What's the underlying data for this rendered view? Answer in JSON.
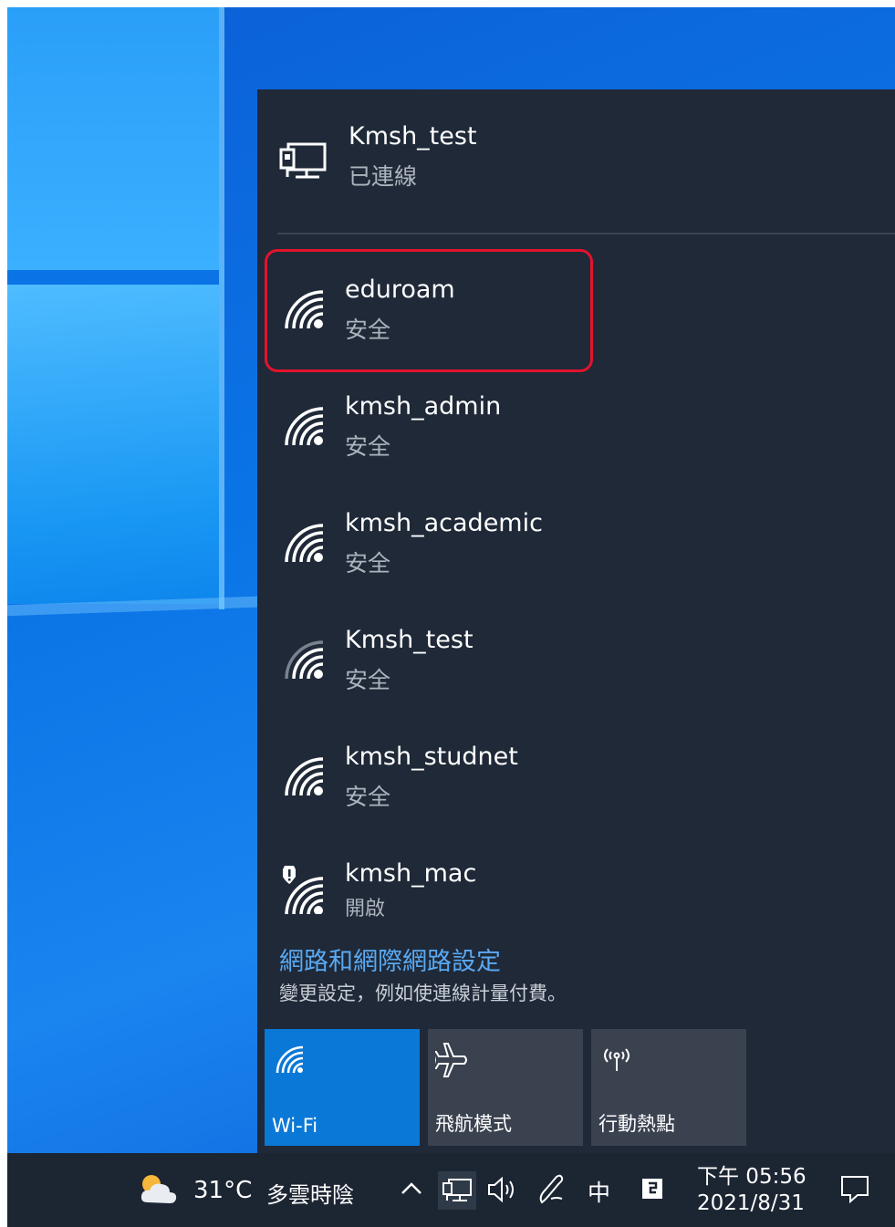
{
  "connected_network": {
    "name": "Kmsh_test",
    "status": "已連線",
    "icon": "ethernet-icon"
  },
  "networks": [
    {
      "name": "eduroam",
      "status": "安全",
      "icon": "wifi-icon",
      "highlighted": true
    },
    {
      "name": "kmsh_admin",
      "status": "安全",
      "icon": "wifi-icon"
    },
    {
      "name": "kmsh_academic",
      "status": "安全",
      "icon": "wifi-icon"
    },
    {
      "name": "Kmsh_test",
      "status": "安全",
      "icon": "wifi-icon"
    },
    {
      "name": "kmsh_studnet",
      "status": "安全",
      "icon": "wifi-icon"
    },
    {
      "name": "kmsh_mac",
      "status": "開啟",
      "icon": "wifi-warning-icon"
    }
  ],
  "settings": {
    "link": "網路和網際網路設定",
    "description": "變更設定，例如使連線計量付費。"
  },
  "quick_actions": [
    {
      "label": "Wi-Fi",
      "icon": "wifi-icon",
      "active": true
    },
    {
      "label": "飛航模式",
      "icon": "airplane-icon",
      "active": false
    },
    {
      "label": "行動熱點",
      "icon": "hotspot-icon",
      "active": false
    }
  ],
  "taskbar": {
    "weather_temp": "31°C",
    "weather_condition": "多雲時陰",
    "ime_label": "中",
    "time": "下午 05:56",
    "date": "2021/8/31"
  },
  "colors": {
    "flyout_bg": "#1f2938",
    "accent": "#0a78d7",
    "link": "#5aa9f2",
    "highlight_border": "#e3132d"
  }
}
